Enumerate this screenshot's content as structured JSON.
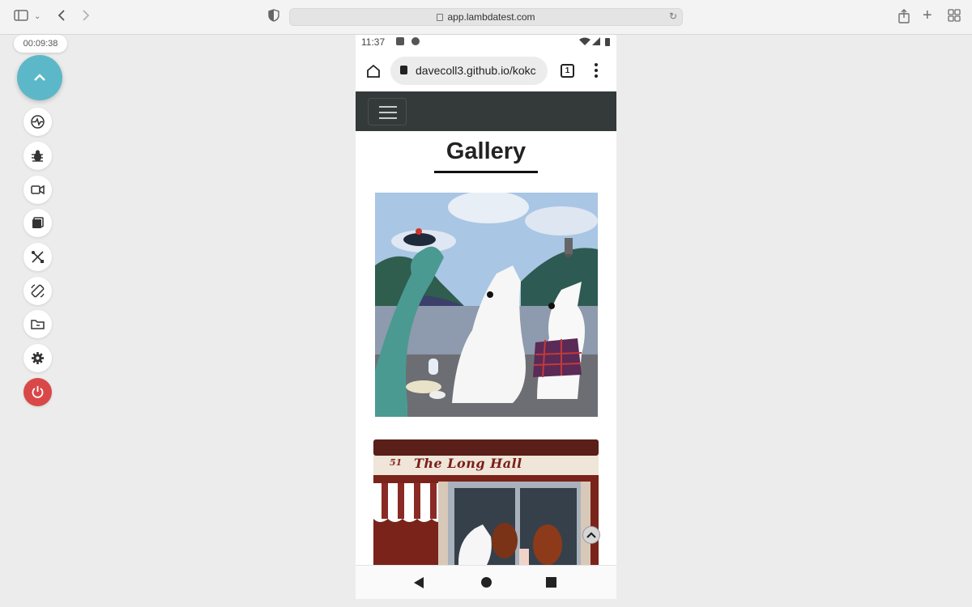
{
  "browser": {
    "url": "app.lambdatest.com"
  },
  "session": {
    "timer": "00:09:38"
  },
  "tools": [
    {
      "name": "device-switch-icon"
    },
    {
      "name": "bug-icon"
    },
    {
      "name": "video-icon"
    },
    {
      "name": "gallery-icon"
    },
    {
      "name": "tools-icon"
    },
    {
      "name": "rotate-icon"
    },
    {
      "name": "folder-icon"
    },
    {
      "name": "gear-icon"
    },
    {
      "name": "power-icon",
      "color": "#d94848"
    }
  ],
  "device": {
    "status_time": "11:37",
    "chrome_url": "davecoll3.github.io/kokc",
    "tab_count": "1"
  },
  "page": {
    "title": "Gallery",
    "sign_text": "The Long Hall",
    "sign_number": "51"
  },
  "colors": {
    "accent": "#5cb8c8",
    "navbar": "#343a3a"
  }
}
